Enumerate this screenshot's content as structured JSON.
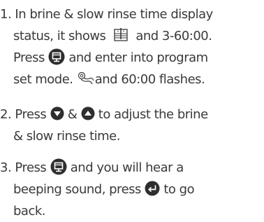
{
  "steps": [
    {
      "number": "1.",
      "line1": "In brine & slow rinse time display",
      "line2_a": "status, it shows",
      "line2_b": "and 3-60:00.",
      "line3_a": "Press",
      "line3_b": "and enter into program",
      "line4_a": "set mode.",
      "line4_b": "and 60:00 flashes."
    },
    {
      "number": "2.",
      "line1_a": "Press",
      "line1_b": "&",
      "line1_c": "to adjust the brine",
      "line2": "& slow rinse time."
    },
    {
      "number": "3.",
      "line1_a": "Press",
      "line1_b": "and you will hear a",
      "line2_a": "beeping sound, press",
      "line2_b": "to go",
      "line3": "back."
    }
  ],
  "icons": {
    "brine_tank": "brine-tank-icon",
    "program": "program-button-icon",
    "rinse_valve": "rinse-valve-icon",
    "down": "down-button-icon",
    "up": "up-button-icon",
    "back": "back-button-icon"
  },
  "colors": {
    "text": "#3a3a3a",
    "button_fill": "#2e2e2e",
    "button_glyph": "#ffffff"
  }
}
